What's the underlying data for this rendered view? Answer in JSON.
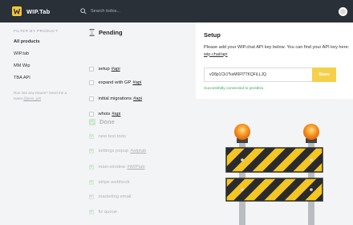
{
  "header": {
    "app_title": "WIP.Tab",
    "search_placeholder": "Search todos..."
  },
  "sidebar": {
    "filter_heading": "FILTER BY PRODUCT",
    "items": [
      {
        "label": "All products",
        "active": true
      },
      {
        "label": "WIP.tab",
        "active": false
      },
      {
        "label": "MM Wip",
        "active": false
      },
      {
        "label": "TBA API",
        "active": false
      }
    ],
    "note_text": "Run into any issues? Send me a tweet",
    "note_link": "@jens_joh"
  },
  "pending": {
    "title": "Pending",
    "tasks": [
      {
        "text": "setup",
        "tag": "#api"
      },
      {
        "text": "expand with GP",
        "tag": "#api"
      },
      {
        "text": "initial migrations",
        "tag": "#api"
      },
      {
        "text": "whois",
        "tag": "#api"
      }
    ]
  },
  "done": {
    "title": "Done",
    "tasks": [
      {
        "text": "new test todo",
        "tag": ""
      },
      {
        "text": "settings popup",
        "tag": "#wiptab"
      },
      {
        "text": "main-window",
        "tag": "#WIPtab"
      },
      {
        "text": "stripe webhook",
        "tag": ""
      },
      {
        "text": "marketing email",
        "tag": ""
      },
      {
        "text": "fix queue",
        "tag": ""
      }
    ]
  },
  "setup": {
    "title": "Setup",
    "description": "Please add your WIP.chat API key below. You can find your API key here:",
    "link": "wip.chat/api",
    "api_key_value": "vD8p1Ck1*ksM6Ff7TKQFiLLJQ",
    "save_label": "Save",
    "success_message": "Successfully connected to jenstbra"
  },
  "colors": {
    "topbar": "#2a3038",
    "accent_yellow": "#f5d04a",
    "success_green": "#3aa655",
    "done_green": "#6fcf6f",
    "barricade_orange": "#f48a1a",
    "barricade_stripe": "#f3c623"
  }
}
